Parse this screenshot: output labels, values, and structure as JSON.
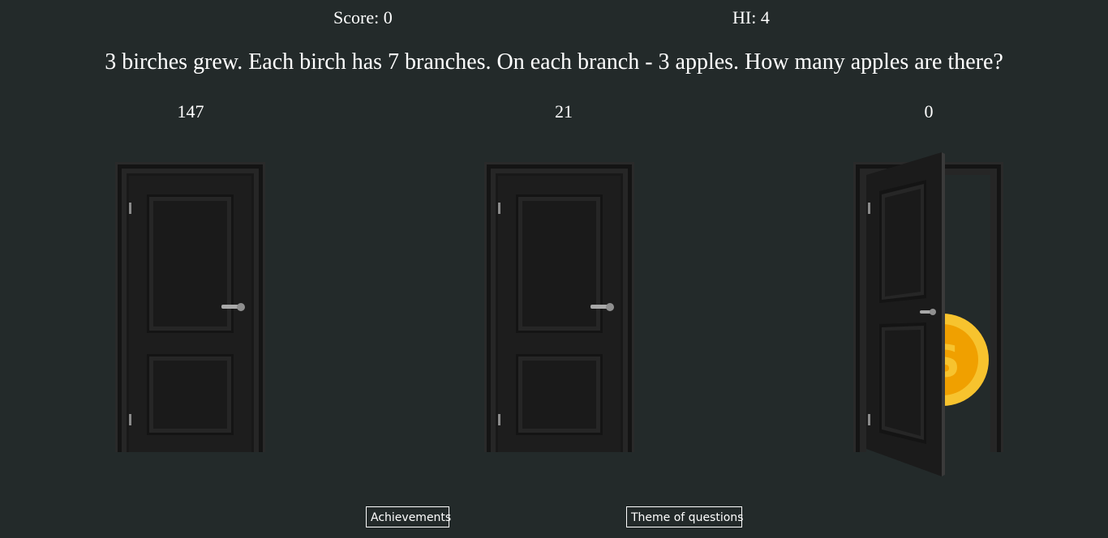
{
  "hud": {
    "score_label": "Score: 0",
    "hi_label": "HI: 4"
  },
  "question": {
    "text": "3 birches grew. Each birch has 7 branches. On each branch - 3 apples. How many apples are there?"
  },
  "answers": [
    {
      "label": "147",
      "door_state": "closed"
    },
    {
      "label": "21",
      "door_state": "closed"
    },
    {
      "label": "0",
      "door_state": "open",
      "reveal": "coin-icon"
    }
  ],
  "buttons": {
    "achievements": "Achievements",
    "theme": "Theme of questions"
  },
  "colors": {
    "background": "#232a2a",
    "door": "#1c1c1c",
    "coin_outer": "#f7c32e",
    "coin_inner": "#f0a000"
  }
}
